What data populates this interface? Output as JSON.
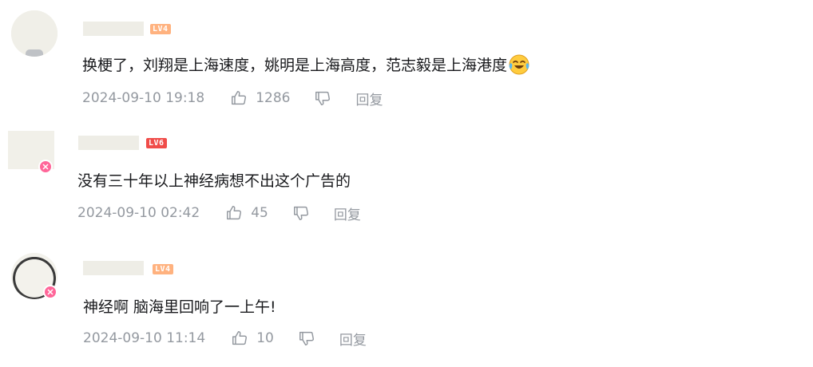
{
  "comments": [
    {
      "level": "LV4",
      "text": "换梗了，刘翔是上海速度，姚明是上海高度，范志毅是上海港度",
      "emoji": "laughing-crying-emoji",
      "time": "2024-09-10 19:18",
      "likes": "1286",
      "reply_label": "回复"
    },
    {
      "level": "LV6",
      "text": "没有三十年以上神经病想不出这个广告的",
      "time": "2024-09-10 02:42",
      "likes": "45",
      "reply_label": "回复"
    },
    {
      "level": "LV4",
      "text": "神经啊 脑海里回响了一上午!",
      "time": "2024-09-10 11:14",
      "likes": "10",
      "reply_label": "回复"
    }
  ],
  "colors": {
    "text": "#18191c",
    "meta": "#9499a0",
    "level_orange": "#ffb27f",
    "level_red": "#f04c49",
    "badge_pink": "#ff6699"
  },
  "icons": [
    "thumbs-up-icon",
    "thumbs-down-icon"
  ]
}
